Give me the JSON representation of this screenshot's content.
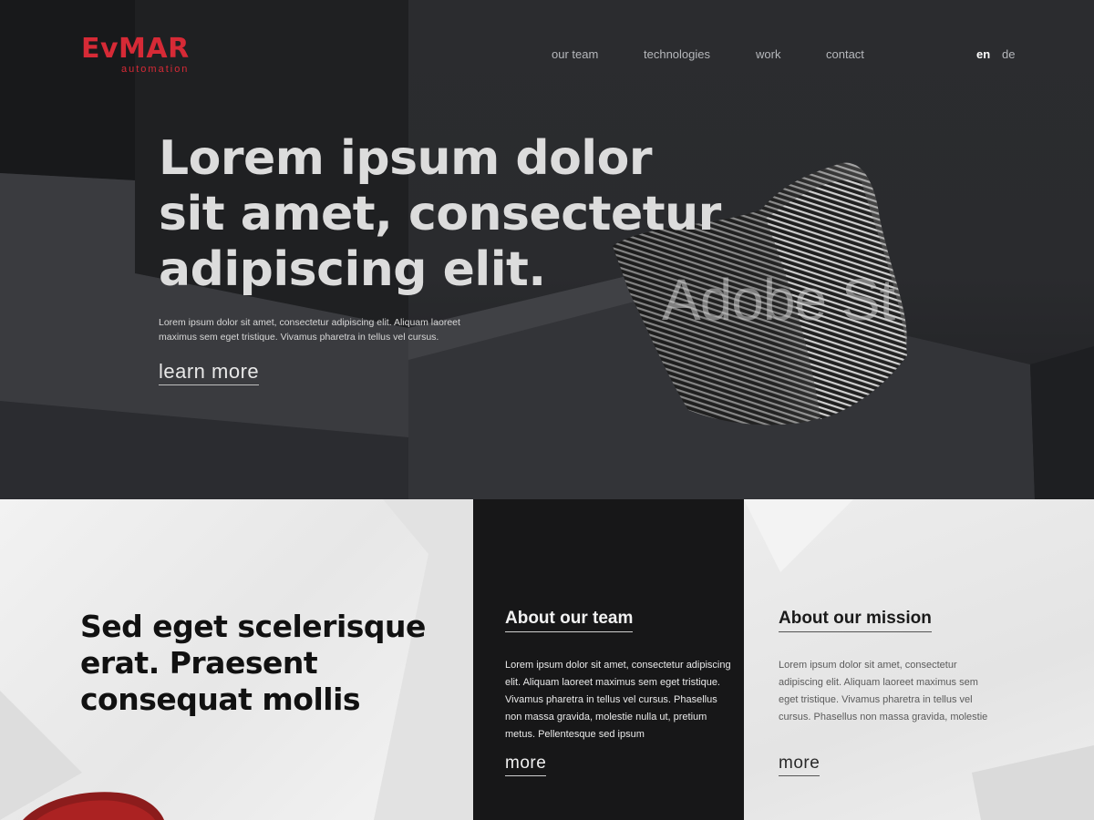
{
  "brand": {
    "name": "EvMAR",
    "tagline": "automation",
    "color": "#d62a36"
  },
  "nav": {
    "items": [
      {
        "label": "our team"
      },
      {
        "label": "technologies"
      },
      {
        "label": "work"
      },
      {
        "label": "contact"
      }
    ],
    "languages": [
      {
        "label": "en",
        "active": true
      },
      {
        "label": "de",
        "active": false
      }
    ]
  },
  "hero": {
    "title_lines": [
      "Lorem ipsum dolor",
      "sit amet, consectetur",
      "adipiscing elit."
    ],
    "text": "Lorem ipsum dolor sit amet, consectetur adipiscing elit. Aliquam laoreet maximus sem eget tristique. Vivamus pharetra in tellus vel cursus.",
    "link_label": "learn more",
    "watermark": "Adobe St"
  },
  "intro": {
    "title_lines": [
      "Sed eget scelerisque",
      "erat. Praesent",
      "consequat mollis"
    ]
  },
  "cards": [
    {
      "title": "About our team",
      "text": "Lorem ipsum dolor sit amet, consectetur adipiscing elit. Aliquam laoreet maximus sem eget tristique. Vivamus pharetra in tellus vel cursus. Phasellus non massa gravida, molestie nulla ut, pretium metus. Pellentesque sed ipsum",
      "more_label": "more"
    },
    {
      "title": "About our mission",
      "text": "Lorem ipsum dolor sit amet, consectetur adipiscing elit. Aliquam laoreet maximus sem eget tristique. Vivamus pharetra in tellus vel cursus. Phasellus non massa gravida, molestie",
      "more_label": "more"
    }
  ]
}
